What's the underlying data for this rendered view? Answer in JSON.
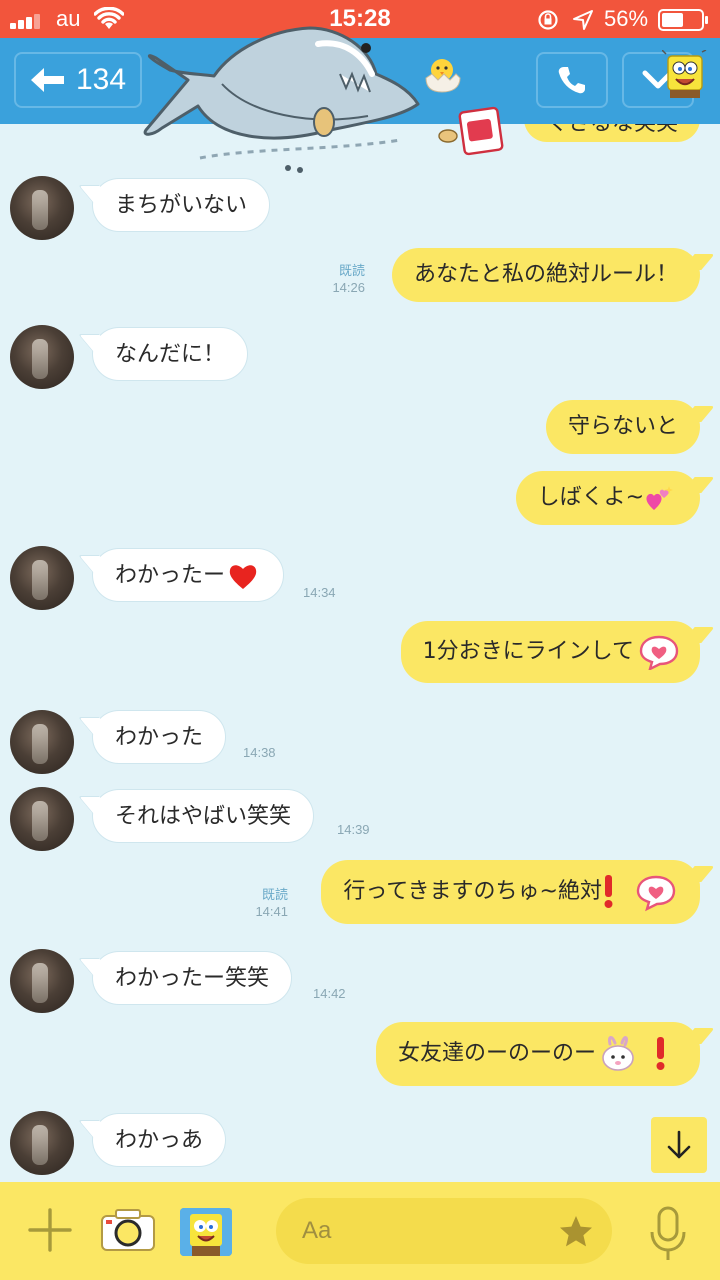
{
  "status_bar": {
    "carrier": "au",
    "time": "15:28",
    "battery_percent": "56%",
    "battery_level": 0.56,
    "background_color": "#f2553c"
  },
  "header": {
    "back_count": "134",
    "background_color": "#3aa1dc",
    "icons": [
      "back-arrow-icon",
      "phone-icon",
      "chevron-down-icon"
    ]
  },
  "messages": [
    {
      "side": "out",
      "text": "くさるな笑笑",
      "read": "",
      "time": ""
    },
    {
      "side": "in",
      "text": "まちがいない",
      "time": ""
    },
    {
      "side": "out",
      "text": "あなたと私の絶対ルール！",
      "read": "既読",
      "time": "14:26"
    },
    {
      "side": "in",
      "text": "なんだに！",
      "time": ""
    },
    {
      "side": "out",
      "text": "守らないと",
      "read": "",
      "time": ""
    },
    {
      "side": "out",
      "text": "しばくよ~",
      "emoji": "sparkling-hearts-icon",
      "read": "",
      "time": ""
    },
    {
      "side": "in",
      "text": "わかったー",
      "emoji": "red-heart-icon",
      "time": "14:34"
    },
    {
      "side": "out",
      "text": "1分おきにラインして",
      "emoji": "heart-speech-bubble-icon",
      "read": "",
      "time": ""
    },
    {
      "side": "in",
      "text": "わかった",
      "time": "14:38"
    },
    {
      "side": "in",
      "text": "それはやばい笑笑",
      "time": "14:39"
    },
    {
      "side": "out",
      "text": "行ってきますのちゅ~絶対",
      "emoji": "exclamation-heart-bubble-icon",
      "read": "既読",
      "time": "14:41"
    },
    {
      "side": "in",
      "text": "わかったー笑笑",
      "time": "14:42"
    },
    {
      "side": "out",
      "text": "女友達のーのーのー",
      "emoji": "bunny-exclamation-icon",
      "read": "",
      "time": ""
    },
    {
      "side": "in",
      "text": "わかっあ",
      "time": ""
    }
  ],
  "input_bar": {
    "placeholder": "Aa",
    "background_color": "#fbe764",
    "icons": [
      "plus-icon",
      "camera-icon",
      "sticker-icon",
      "star-icon",
      "microphone-icon"
    ]
  },
  "colors": {
    "chat_background": "#e3f3f8",
    "outgoing_bubble": "#fbe764",
    "incoming_bubble": "#ffffff"
  }
}
